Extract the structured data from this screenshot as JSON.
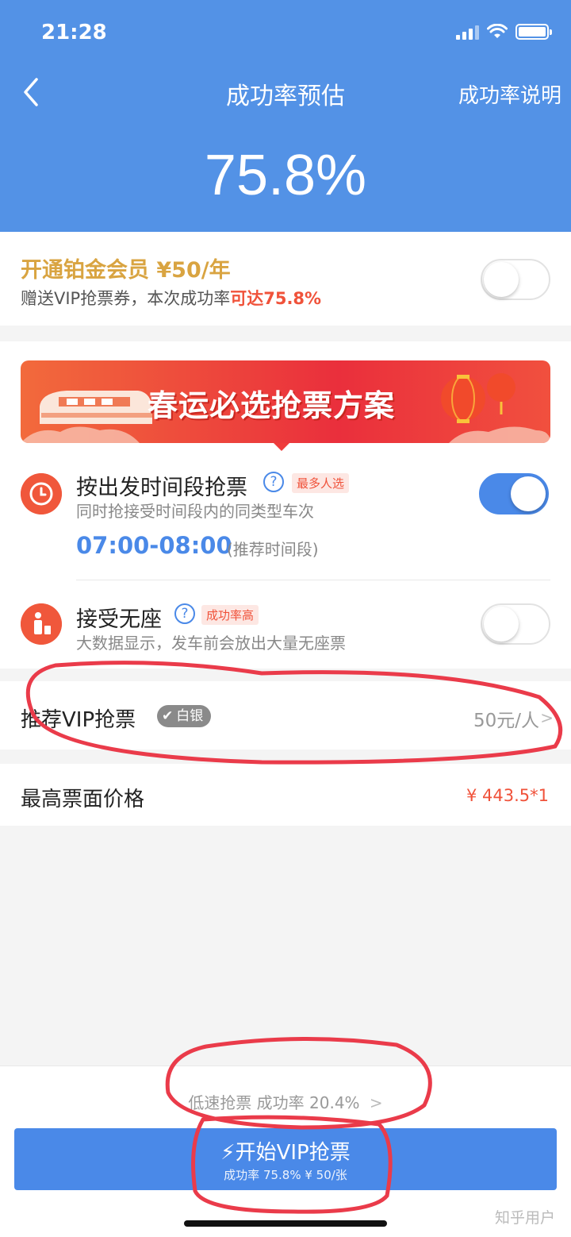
{
  "status_bar": {
    "time": "21:28"
  },
  "nav": {
    "title": "成功率预估",
    "right_link": "成功率说明"
  },
  "success_rate": "75.8%",
  "vip_promo": {
    "title": "开通铂金会员 ¥50/年",
    "subtitle_prefix": "赠送VIP抢票券，本次成功率",
    "subtitle_highlight": "可达75.8%",
    "toggle_on": false
  },
  "banner": {
    "text": "春运必选抢票方案"
  },
  "option_time": {
    "title": "按出发时间段抢票",
    "tag": "最多人选",
    "subtitle": "同时抢接受时间段内的同类型车次",
    "time_range": "07:00-08:00",
    "time_note": "(推荐时间段)",
    "toggle_on": true
  },
  "option_no_seat": {
    "title": "接受无座",
    "tag": "成功率高",
    "subtitle": "大数据显示，发车前会放出大量无座票",
    "toggle_on": false
  },
  "vip_ticket": {
    "label": "推荐VIP抢票",
    "badge": "白银",
    "value": "50元/人"
  },
  "max_price": {
    "label": "最高票面价格",
    "value": "¥ 443.5*1"
  },
  "bottom": {
    "low_speed": "低速抢票 成功率 20.4%",
    "start_button": "开始VIP抢票",
    "start_sub": "成功率 75.8% ¥ 50/张",
    "watermark": "知乎用户"
  }
}
